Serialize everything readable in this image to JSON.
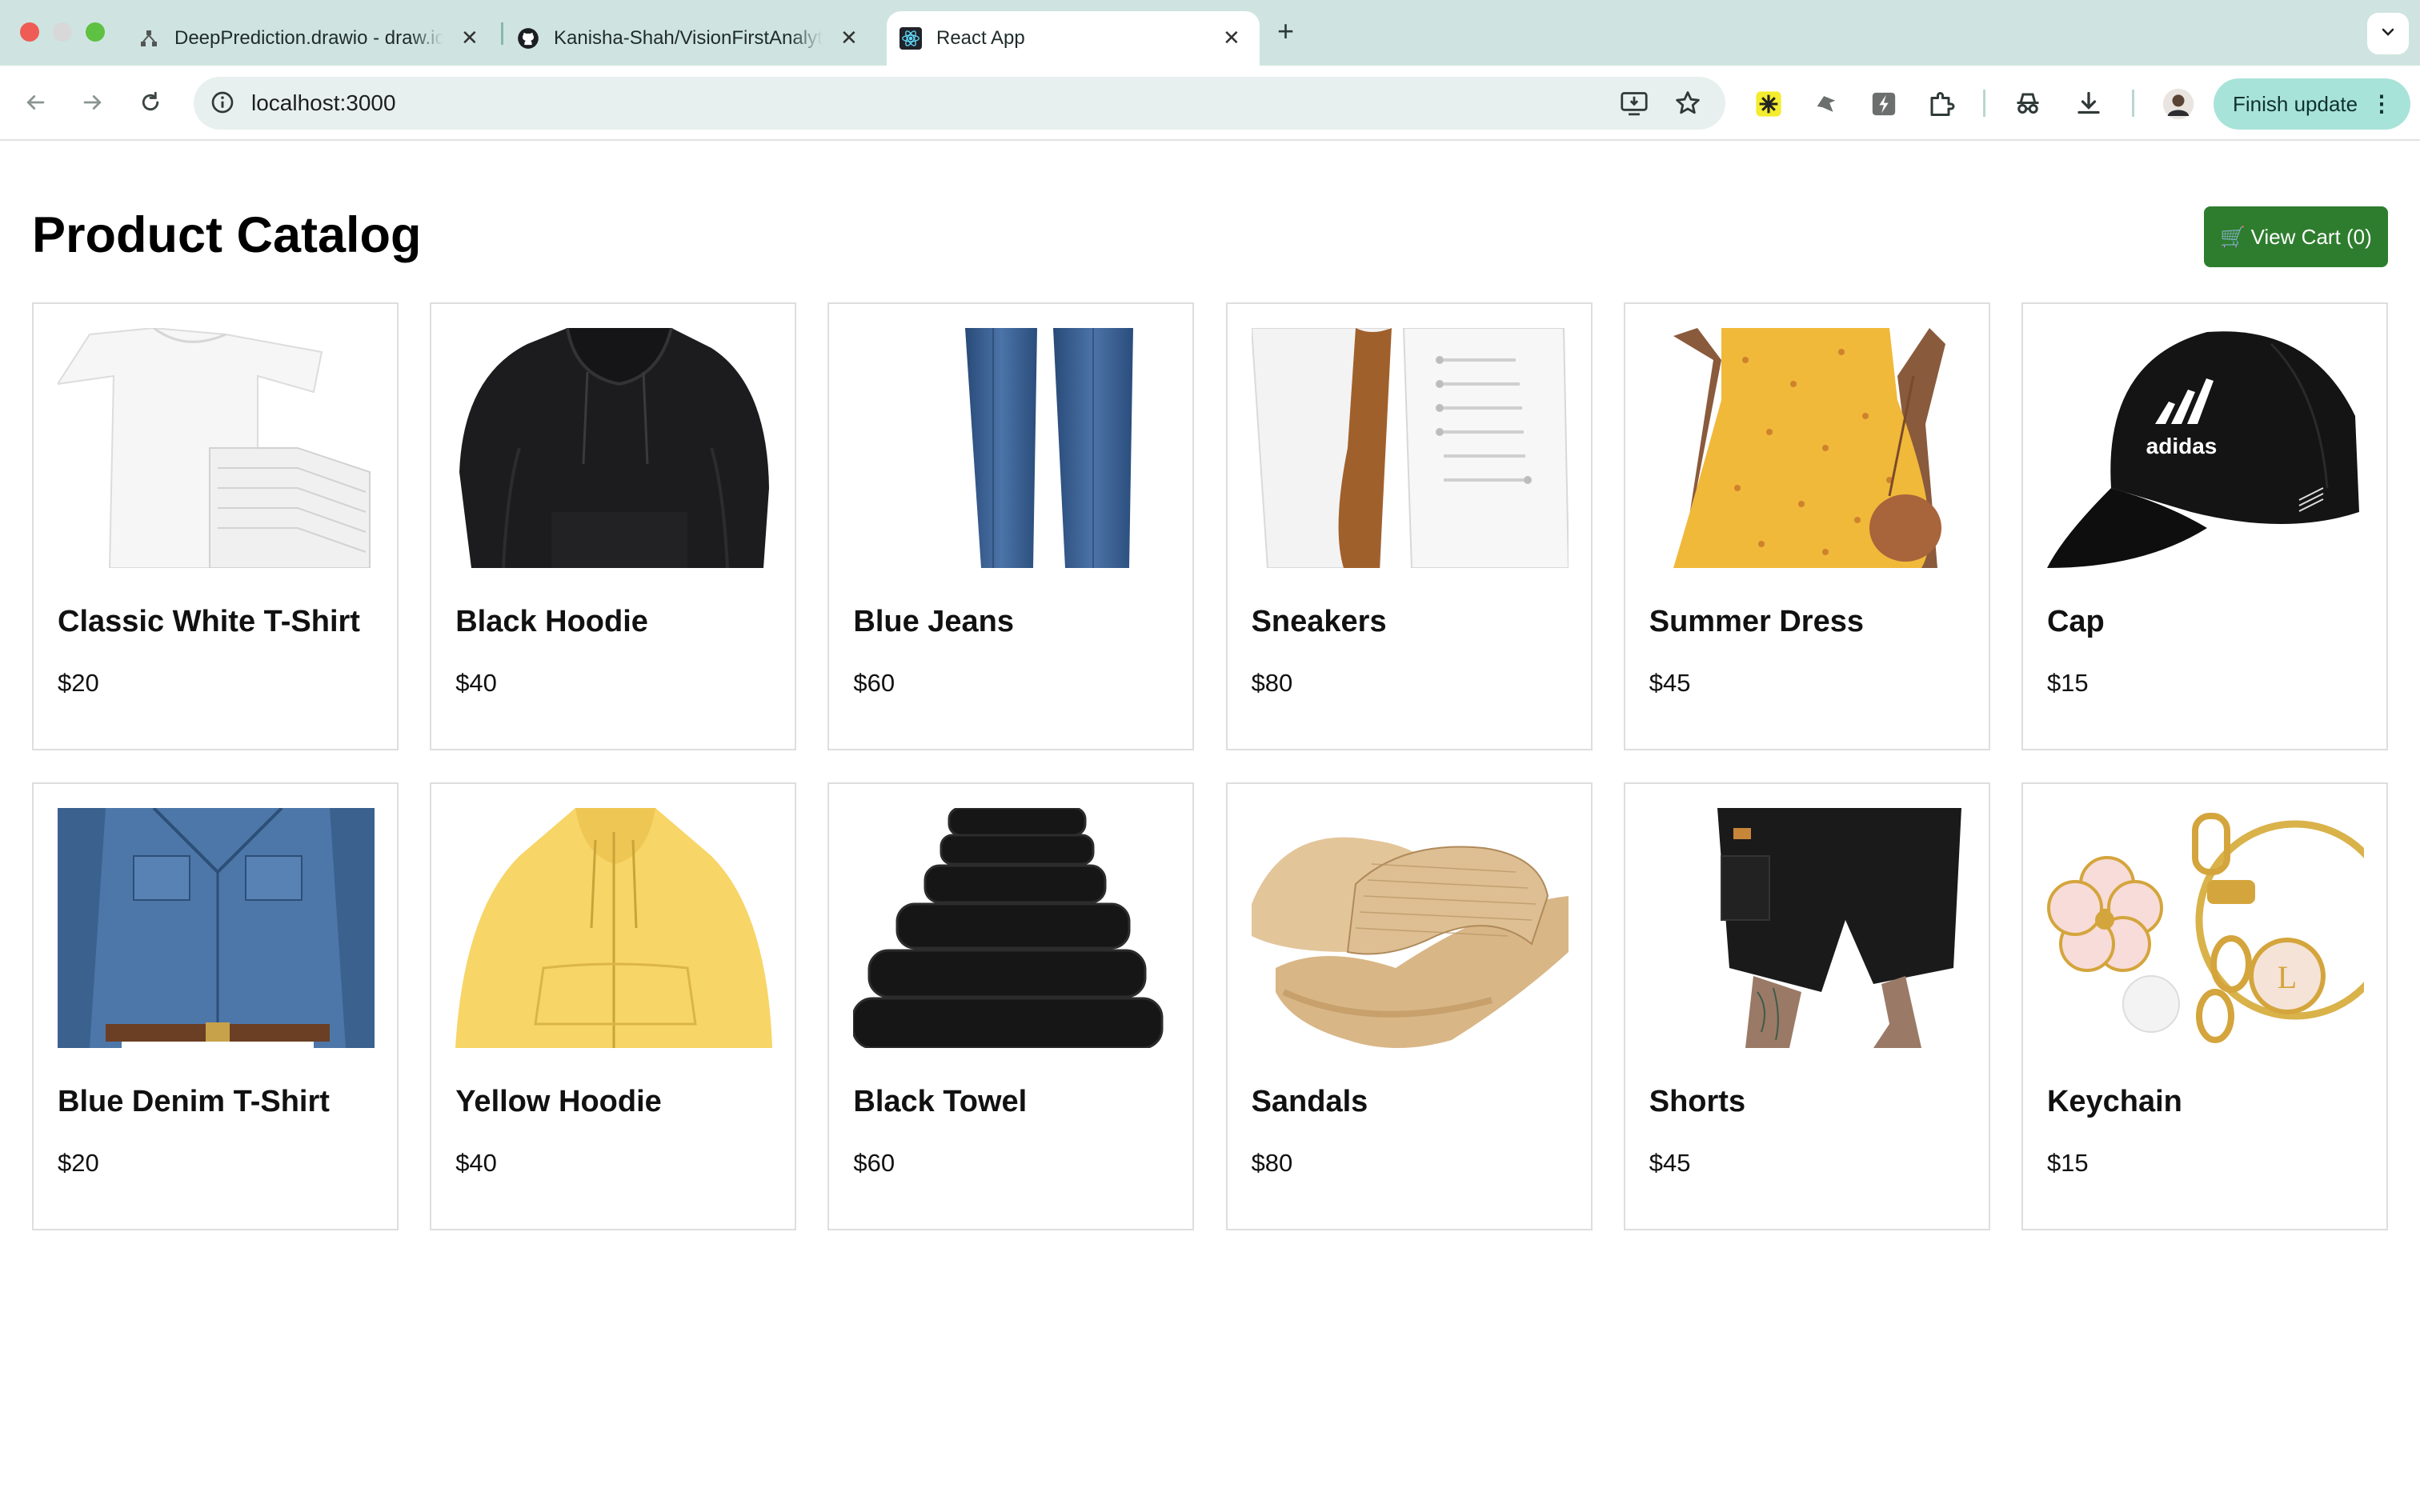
{
  "browser": {
    "tabs": [
      {
        "title": "DeepPrediction.drawio - draw.io",
        "icon": "drawio-icon"
      },
      {
        "title": "Kanisha-Shah/VisionFirstAnalytics",
        "icon": "github-icon"
      },
      {
        "title": "React App",
        "icon": "react-icon",
        "active": true
      }
    ],
    "url": "localhost:3000",
    "finish_update_label": "Finish update",
    "accent_color": "#a8e3da"
  },
  "page": {
    "title": "Product Catalog",
    "cart_icon": "🛒",
    "cart_button_label": "View Cart (0)",
    "cart_button_color": "#2e7d2e"
  },
  "products": [
    {
      "name": "Classic White T-Shirt",
      "price": "$20",
      "image": "white-tshirt"
    },
    {
      "name": "Black Hoodie",
      "price": "$40",
      "image": "black-hoodie"
    },
    {
      "name": "Blue Jeans",
      "price": "$60",
      "image": "blue-jeans"
    },
    {
      "name": "Sneakers",
      "price": "$80",
      "image": "white-sneakers"
    },
    {
      "name": "Summer Dress",
      "price": "$45",
      "image": "yellow-dress"
    },
    {
      "name": "Cap",
      "price": "$15",
      "image": "black-cap",
      "logo_text": "adidas"
    },
    {
      "name": "Blue Denim T-Shirt",
      "price": "$20",
      "image": "denim-shirt"
    },
    {
      "name": "Yellow Hoodie",
      "price": "$40",
      "image": "yellow-hoodie"
    },
    {
      "name": "Black Towel",
      "price": "$60",
      "image": "black-towels"
    },
    {
      "name": "Sandals",
      "price": "$80",
      "image": "woven-sandals"
    },
    {
      "name": "Shorts",
      "price": "$45",
      "image": "black-shorts"
    },
    {
      "name": "Keychain",
      "price": "$15",
      "image": "flower-keychain",
      "logo_text": "L"
    }
  ]
}
